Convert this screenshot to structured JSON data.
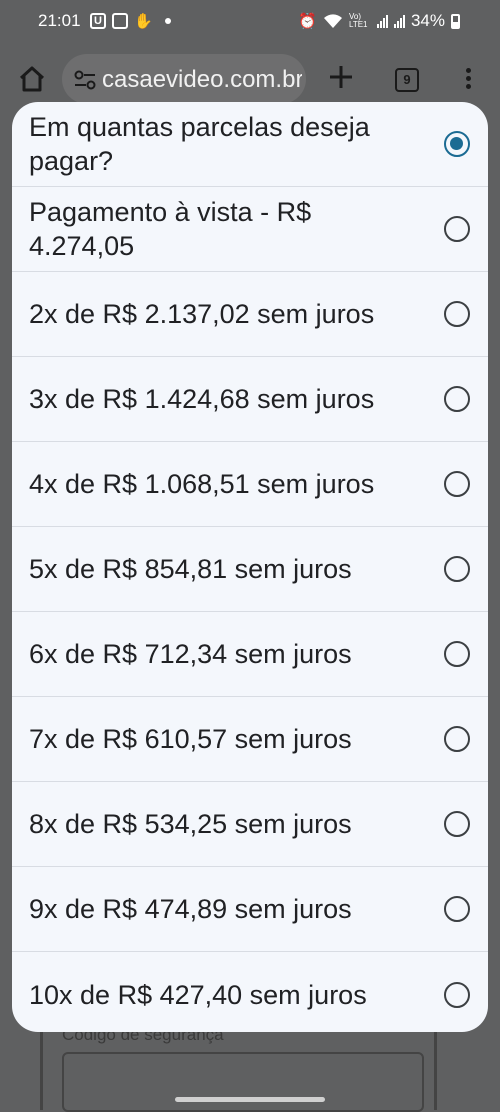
{
  "status_bar": {
    "time": "21:01",
    "battery": "34%",
    "network": "Vo) LTE1"
  },
  "browser": {
    "url": "casaevideo.com.br",
    "tab_count": "9"
  },
  "background": {
    "field_label": "Código de segurança"
  },
  "dialog": {
    "selected_index": 0,
    "options": [
      {
        "label": "Em quantas parcelas deseja pagar?",
        "checked": true
      },
      {
        "label": "Pagamento à vista - R$ 4.274,05",
        "checked": false
      },
      {
        "label": "2x de R$ 2.137,02 sem juros",
        "checked": false
      },
      {
        "label": "3x de R$ 1.424,68 sem juros",
        "checked": false
      },
      {
        "label": "4x de R$ 1.068,51 sem juros",
        "checked": false
      },
      {
        "label": "5x de R$ 854,81 sem juros",
        "checked": false
      },
      {
        "label": "6x de R$ 712,34 sem juros",
        "checked": false
      },
      {
        "label": "7x de R$ 610,57 sem juros",
        "checked": false
      },
      {
        "label": "8x de R$ 534,25 sem juros",
        "checked": false
      },
      {
        "label": "9x de R$ 474,89 sem juros",
        "checked": false
      },
      {
        "label": "10x de R$ 427,40 sem juros",
        "checked": false
      }
    ]
  },
  "colors": {
    "radio_selected": "#1b6b93",
    "dialog_bg": "#f4f7fc",
    "scrim": "#5f6061"
  }
}
